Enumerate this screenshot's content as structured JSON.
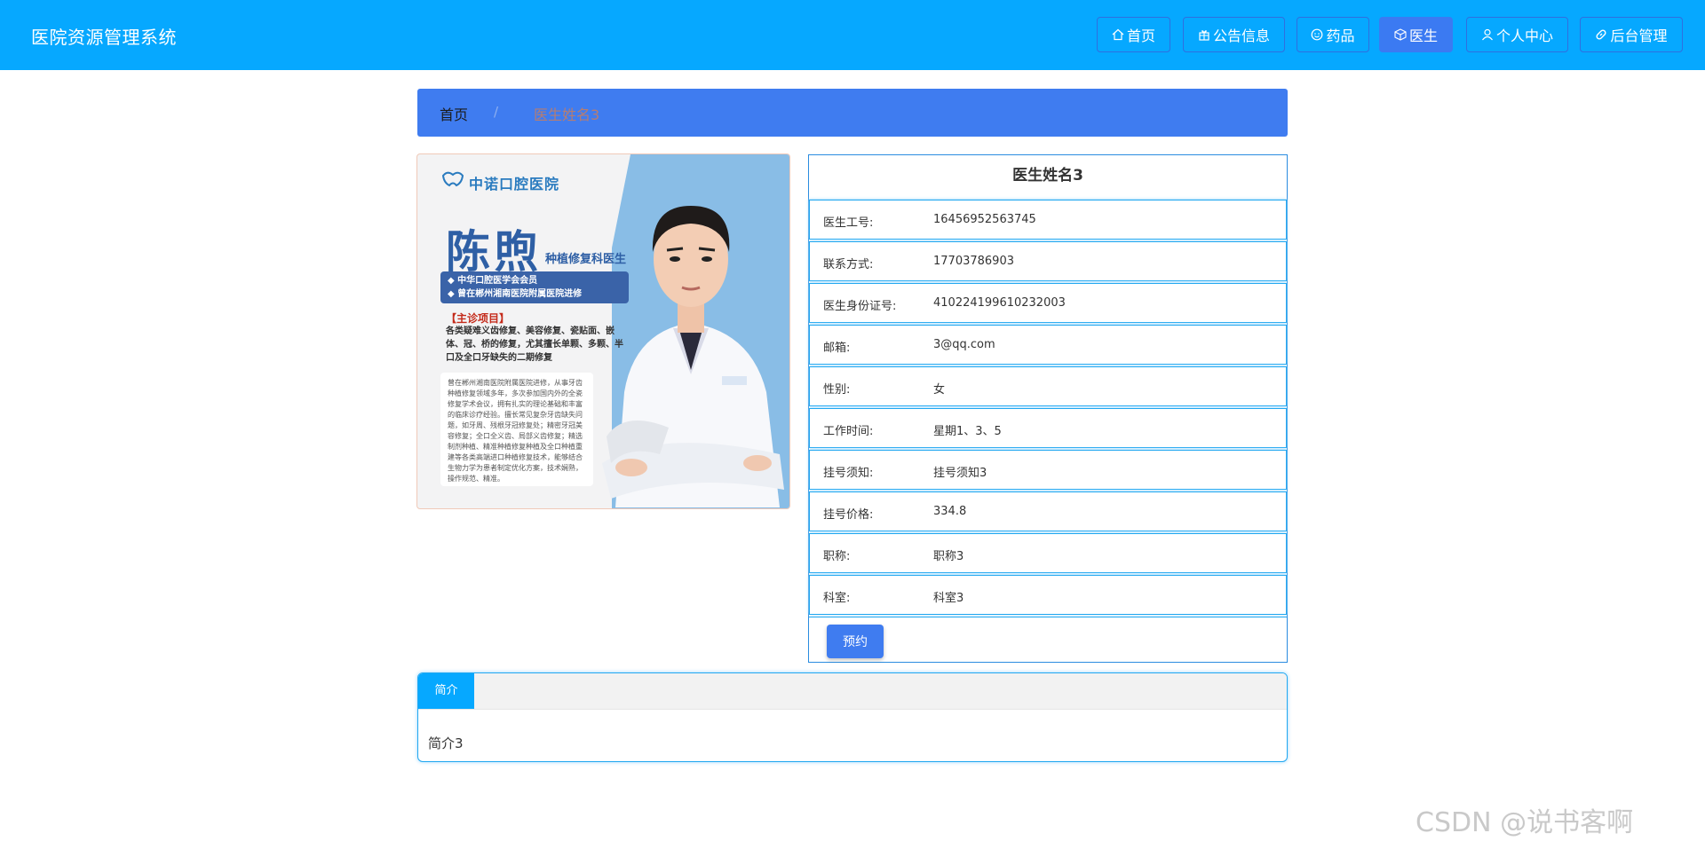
{
  "app": {
    "title": "医院资源管理系统"
  },
  "nav": [
    {
      "label": "首页",
      "icon": "home-icon",
      "active": false
    },
    {
      "label": "公告信息",
      "icon": "gift-icon",
      "active": false
    },
    {
      "label": "药品",
      "icon": "smile-icon",
      "active": false
    },
    {
      "label": "医生",
      "icon": "box-icon",
      "active": true
    },
    {
      "label": "个人中心",
      "icon": "user-icon",
      "active": false
    },
    {
      "label": "后台管理",
      "icon": "link-icon",
      "active": false
    }
  ],
  "breadcrumb": {
    "home": "首页",
    "separator": "/",
    "current": "医生姓名3"
  },
  "photo": {
    "hospital": "中诺口腔医院",
    "name": "陈煦",
    "role": "种植修复科医生",
    "badge_line1": "◆ 中华口腔医学会会员",
    "badge_line2": "◆ 曾在郴州湘南医院附属医院进修",
    "section_title": "【主诊项目】",
    "projects": "各类疑难义齿修复、美容修复、瓷贴面、嵌体、冠、桥的修复，尤其擅长单颗、多颗、半口及全口牙缺失的二期修复",
    "description": "曾在郴州湘南医院附属医院进修，从事牙齿种植修复领域多年，多次参加国内外的全瓷修复学术会议，拥有扎实的理论基础和丰富的临床诊疗经验。擅长常见复杂牙齿缺失问题，如牙周、残根牙冠修复处；精密牙冠美容修复；全口全义齿、局部义齿修复；精选制剂种植、精准种植修复种植及全口种植重建等各类高端进口种植修复技术，能够结合生物力学为患者制定优化方案，技术娴熟，操作规范、精准。"
  },
  "doctor": {
    "title": "医生姓名3",
    "fields": [
      {
        "label": "医生工号:",
        "value": "16456952563745"
      },
      {
        "label": "联系方式:",
        "value": "17703786903"
      },
      {
        "label": "医生身份证号:",
        "value": "410224199610232003"
      },
      {
        "label": "邮箱:",
        "value": "3@qq.com"
      },
      {
        "label": "性别:",
        "value": "女"
      },
      {
        "label": "工作时间:",
        "value": "星期1、3、5"
      },
      {
        "label": "挂号须知:",
        "value": "挂号须知3"
      },
      {
        "label": "挂号价格:",
        "value": "334.8"
      },
      {
        "label": "职称:",
        "value": "职称3"
      },
      {
        "label": "科室:",
        "value": "科室3"
      }
    ],
    "book_label": "预约"
  },
  "intro": {
    "tab_label": "简介",
    "content": "简介3"
  },
  "watermark": "CSDN @说书客啊",
  "colors": {
    "header": "#06a8ff",
    "accent": "#3f7cf0",
    "border": "#22a8f0"
  }
}
